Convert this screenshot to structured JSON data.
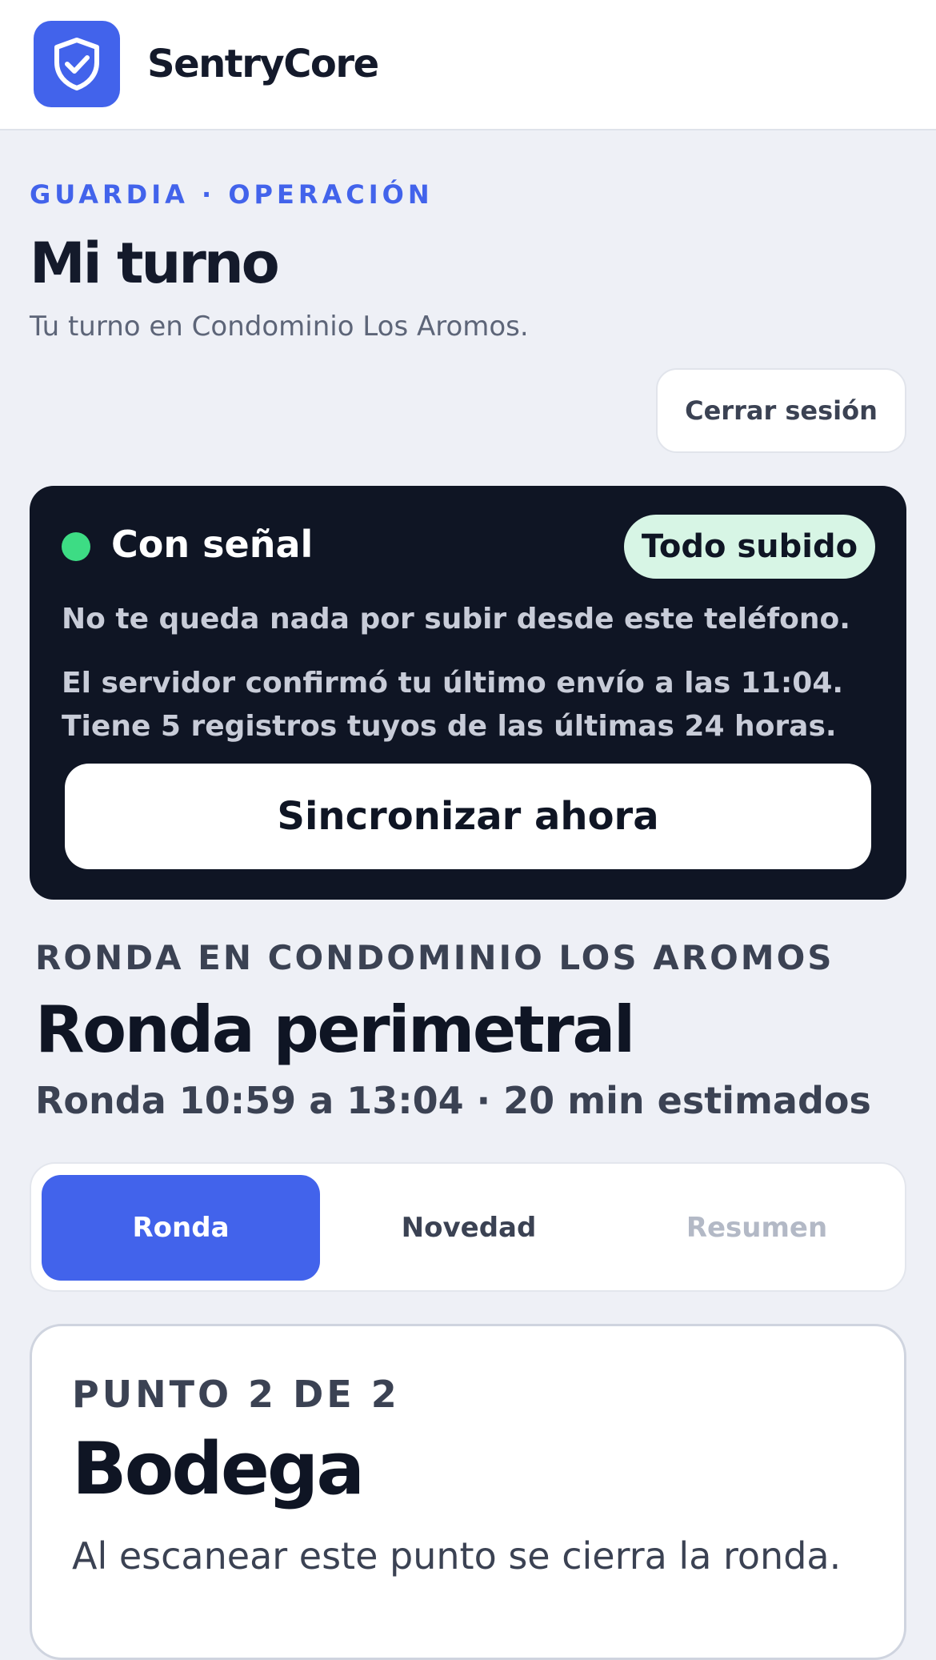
{
  "app": {
    "name": "SentryCore",
    "logo_icon": "shield-check-icon",
    "brand_color": "#4263eb"
  },
  "header": {
    "eyebrow": "GUARDIA · OPERACIÓN",
    "title": "Mi turno",
    "subtitle": "Tu turno en Condominio Los Aromos.",
    "logout_label": "Cerrar sesión"
  },
  "sync": {
    "status": "Con señal",
    "status_color": "#3ddc84",
    "badge": "Todo subido",
    "line1": "No te queda nada por subir desde este teléfono.",
    "line2": "El servidor confirmó tu último envío a las 11:04. Tiene 5 registros tuyos de las últimas 24 horas.",
    "button_label": "Sincronizar ahora"
  },
  "round": {
    "eyebrow": "RONDA EN CONDOMINIO LOS AROMOS",
    "title": "Ronda perimetral",
    "meta": "Ronda 10:59 a 13:04 · 20 min estimados"
  },
  "tabs": [
    {
      "label": "Ronda",
      "state": "active"
    },
    {
      "label": "Novedad",
      "state": "enabled"
    },
    {
      "label": "Resumen",
      "state": "disabled"
    }
  ],
  "point": {
    "eyebrow": "PUNTO 2 DE 2",
    "title": "Bodega",
    "description": "Al escanear este punto se cierra la ronda."
  }
}
